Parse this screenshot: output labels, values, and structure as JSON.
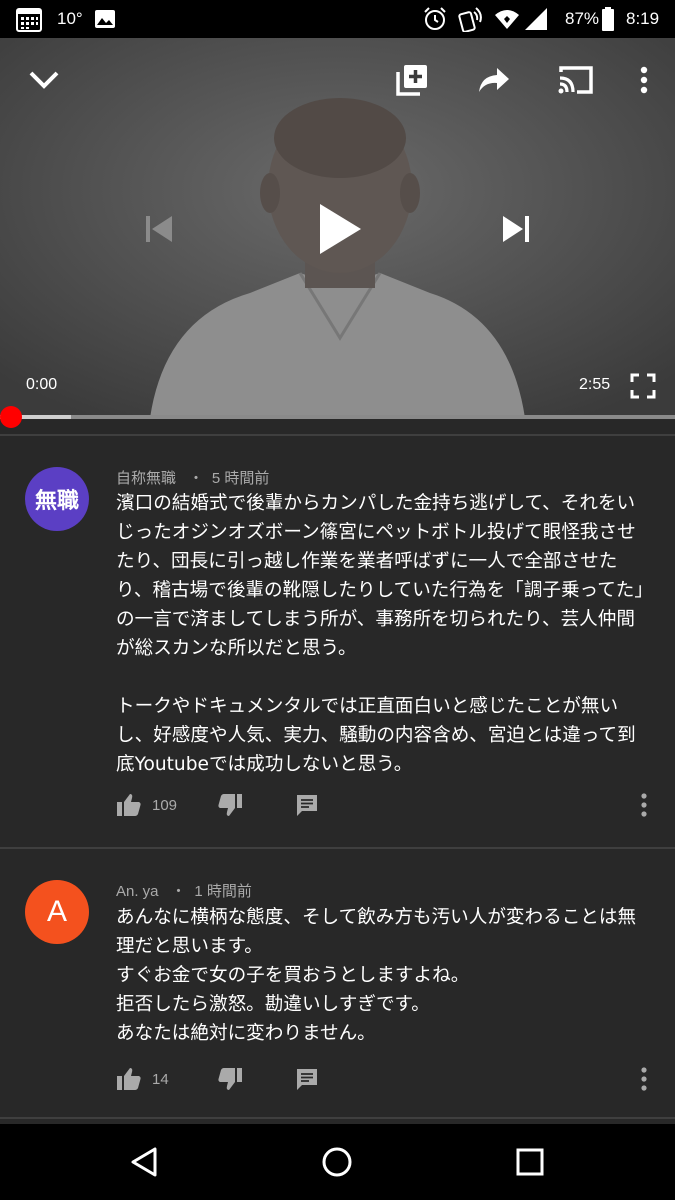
{
  "status_bar": {
    "temperature": "10°",
    "battery": "87%",
    "time": "8:19"
  },
  "player": {
    "current_time": "0:00",
    "duration": "2:55",
    "progress": 0.0,
    "buffered": 0.105
  },
  "comments": [
    {
      "avatar_text": "無職",
      "avatar_color": "#5b3fc4",
      "author": "自称無職",
      "age": "5 時間前",
      "text": "濱口の結婚式で後輩からカンパした金持ち逃げして、それをいじったオジンオズボーン篠宮にペットボトル投げて眼怪我させたり、団長に引っ越し作業を業者呼ばずに一人で全部させたり、稽古場で後輩の靴隠したりしていた行為を「調子乗ってた」の一言で済ましてしまう所が、事務所を切られたり、芸人仲間が総スカンな所以だと思う。\n\nトークやドキュメンタルでは正直面白いと感じたことが無いし、好感度や人気、実力、騒動の内容含め、宮迫とは違って到底Youtubeでは成功しないと思う。",
      "likes": "109"
    },
    {
      "avatar_text": "A",
      "avatar_color": "#f4511e",
      "author": "An. ya",
      "age": "1 時間前",
      "text": "あんなに横柄な態度、そして飲み方も汚い人が変わることは無理だと思います。\nすぐお金で女の子を買おうとしますよね。\n拒否したら激怒。勘違いしすぎです。\nあなたは絶対に変わりません。",
      "likes": "14"
    }
  ]
}
